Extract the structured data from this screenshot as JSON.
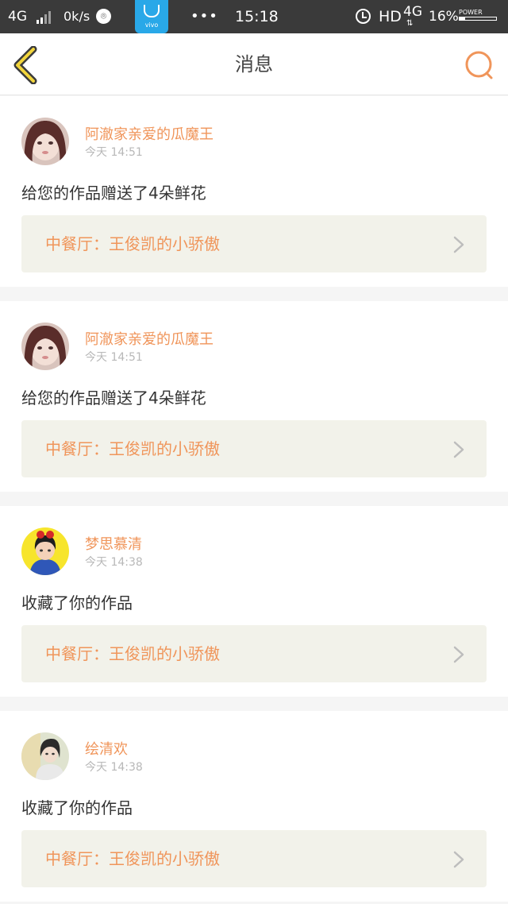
{
  "status_bar": {
    "network": "4G",
    "speed": "0k/s",
    "app_badge": "vivo",
    "dots": "•••",
    "time": "15:18",
    "hd": "HD",
    "network2": "4G",
    "battery": "16%",
    "power_label": "POWER",
    "battery_level": 0.16
  },
  "header": {
    "title": "消息",
    "back_icon": "chevron-left-icon",
    "search_icon": "search-icon",
    "accent_color": "#f0955a"
  },
  "messages": [
    {
      "user": "阿澈家亲爱的瓜魔王",
      "time": "今天 14:51",
      "action": "给您的作品赠送了4朵鲜花",
      "work": "中餐厅：王俊凯的小骄傲"
    },
    {
      "user": "阿澈家亲爱的瓜魔王",
      "time": "今天 14:51",
      "action": "给您的作品赠送了4朵鲜花",
      "work": "中餐厅：王俊凯的小骄傲"
    },
    {
      "user": "梦思慕清",
      "time": "今天 14:38",
      "action": "收藏了你的作品",
      "work": "中餐厅：王俊凯的小骄傲"
    },
    {
      "user": "绘清欢",
      "time": "今天 14:38",
      "action": "收藏了你的作品",
      "work": "中餐厅：王俊凯的小骄傲"
    }
  ]
}
